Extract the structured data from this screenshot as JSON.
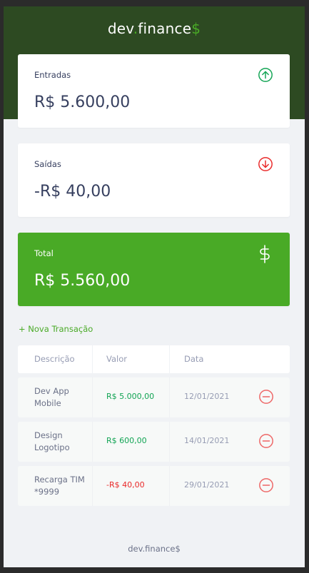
{
  "header": {
    "logo_main": "dev",
    "logo_dot": ".",
    "logo_rest": "finance",
    "logo_symbol": "$"
  },
  "cards": {
    "income": {
      "label": "Entradas",
      "value": "R$ 5.600,00",
      "icon": "arrow-up-circle-icon"
    },
    "expense": {
      "label": "Saídas",
      "value": "-R$ 40,00",
      "icon": "arrow-down-circle-icon"
    },
    "total": {
      "label": "Total",
      "value": "R$ 5.560,00",
      "icon": "dollar-sign-icon"
    }
  },
  "new_transaction_label": "+ Nova Transação",
  "table": {
    "headers": {
      "description": "Descrição",
      "amount": "Valor",
      "date": "Data"
    },
    "rows": [
      {
        "description": "Dev App Mobile",
        "amount": "R$ 5.000,00",
        "date": "12/01/2021",
        "type": "income"
      },
      {
        "description": "Design Logotipo",
        "amount": "R$ 600,00",
        "date": "14/01/2021",
        "type": "income"
      },
      {
        "description": "Recarga TIM *9999",
        "amount": "-R$ 40,00",
        "date": "29/01/2021",
        "type": "expense"
      }
    ]
  },
  "footer": {
    "text": "dev.finance$"
  },
  "colors": {
    "header_bg": "#2d4a22",
    "accent_green": "#49aa26",
    "income": "#12a454",
    "expense": "#e92929",
    "text": "#363f5f",
    "page_bg": "#f0f2f5"
  }
}
